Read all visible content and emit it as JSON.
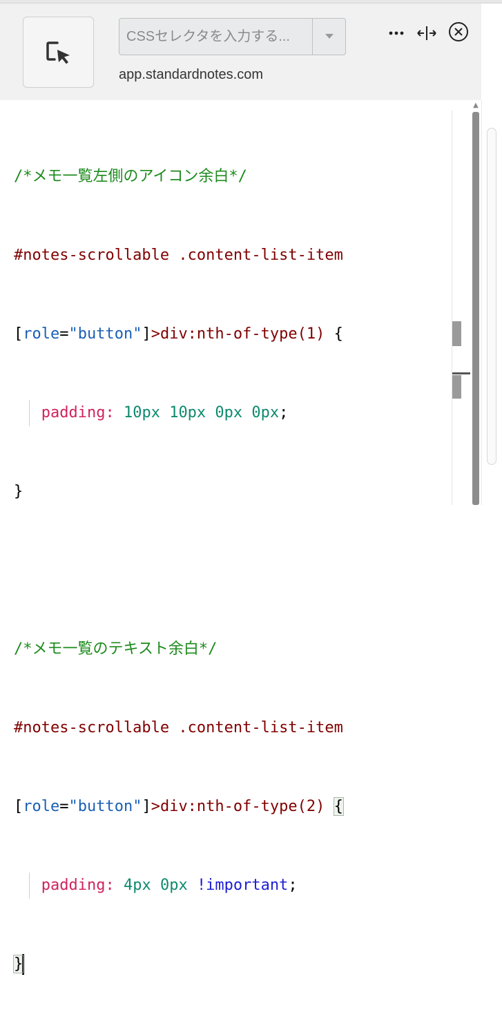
{
  "header": {
    "selector_placeholder": "CSSセレクタを入力する...",
    "url": "app.standardnotes.com",
    "picker_icon": "element-picker-icon",
    "more_icon": "more-horizontal-icon",
    "dock_icon": "resize-horizontal-icon",
    "close_icon": "close-circle-icon"
  },
  "code_lines": [
    "/*メモ一覧左側のアイコン余白*/",
    "#notes-scrollable .content-list-item",
    "[role=\"button\"]>div:nth-of-type(1) {",
    "padding: 10px 10px 0px 0px;",
    "}",
    "",
    "/*メモ一覧のテキスト余白*/",
    "#notes-scrollable .content-list-item",
    "[role=\"button\"]>div:nth-of-type(2) {",
    "padding: 4px 0px !important;",
    "}"
  ],
  "tokens": {
    "comment1": "/*メモ一覧左側のアイコン余白*/",
    "sel": "#notes-scrollable .content-list-item",
    "lbr": "[",
    "attr": "role",
    "eq": "=",
    "str": "\"button\"",
    "rbr": "]",
    "pseudo1": ">div:nth-of-type(1) ",
    "pseudo2": ">div:nth-of-type(2) ",
    "open": "{",
    "close": "}",
    "prop": "padding:",
    "val1": "10px 10px 0px 0px",
    "semi": ";",
    "comment2": "/*メモ一覧のテキスト余白*/",
    "val2": "4px 0px",
    "imp": "!important"
  },
  "colors": {
    "comment": "#1c8a1c",
    "selector": "#800000",
    "attribute": "#1a5fb4",
    "property": "#d0235c",
    "value": "#0e8a6e",
    "important": "#1d1dd6"
  }
}
